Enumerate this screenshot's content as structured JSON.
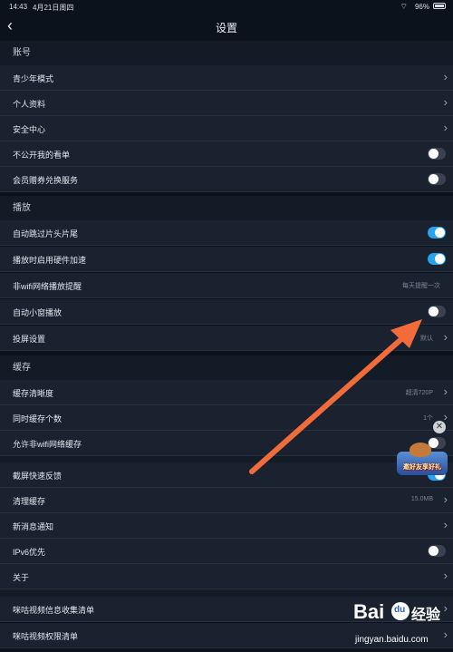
{
  "status_bar": {
    "time": "14:43",
    "date": "4月21日周四",
    "battery": "96%"
  },
  "nav": {
    "title": "设置"
  },
  "sections": [
    {
      "header": "账号",
      "rows": [
        {
          "label": "青少年模式",
          "control": "chevron"
        },
        {
          "label": "个人资料",
          "control": "chevron"
        },
        {
          "label": "安全中心",
          "control": "chevron"
        },
        {
          "label": "不公开我的看单",
          "control": "toggle",
          "on": false
        },
        {
          "label": "会员赠券兑换服务",
          "control": "toggle",
          "on": false
        }
      ]
    },
    {
      "header": "播放",
      "rows": [
        {
          "label": "自动跳过片头片尾",
          "control": "toggle",
          "on": true
        },
        {
          "label": "播放时启用硬件加速",
          "control": "toggle",
          "on": true
        },
        {
          "label": "非wifi网络播放提醒",
          "control": "value",
          "value": "每天提醒一次"
        },
        {
          "label": "自动小窗播放",
          "control": "toggle",
          "on": false
        },
        {
          "label": "投屏设置",
          "control": "chevron",
          "value": "默认"
        }
      ]
    },
    {
      "header": "缓存",
      "rows": [
        {
          "label": "缓存清晰度",
          "control": "chevron",
          "value": "超清720P"
        },
        {
          "label": "同时缓存个数",
          "control": "chevron",
          "value": "1个"
        },
        {
          "label": "允许非wifi网络缓存",
          "control": "toggle",
          "on": false
        }
      ]
    }
  ],
  "other_rows": [
    {
      "label": "截屏快速反馈",
      "control": "toggle",
      "on": true
    },
    {
      "label": "清理缓存",
      "control": "chevron",
      "value": "15.0MB"
    },
    {
      "label": "新消息通知",
      "control": "chevron"
    },
    {
      "label": "IPv6优先",
      "control": "toggle",
      "on": false
    },
    {
      "label": "关于",
      "control": "chevron"
    }
  ],
  "bottom_rows": [
    {
      "label": "咪咕视频信息收集清单",
      "control": "chevron"
    },
    {
      "label": "咪咕视频权限清单",
      "control": "chevron"
    }
  ],
  "promo": {
    "text": "邀好友享好礼"
  },
  "watermark": {
    "brand": "Bai",
    "brand2": "经验",
    "url": "jingyan.baidu.com"
  },
  "colors": {
    "accent": "#29a3ee",
    "annotation_arrow": "#f26b3a",
    "background": "#0c121c",
    "row": "#1a2230"
  },
  "icons": {
    "back": "chevron-left-icon",
    "row_chevron": "chevron-right-icon",
    "wifi": "wifi-icon",
    "battery": "battery-icon"
  }
}
